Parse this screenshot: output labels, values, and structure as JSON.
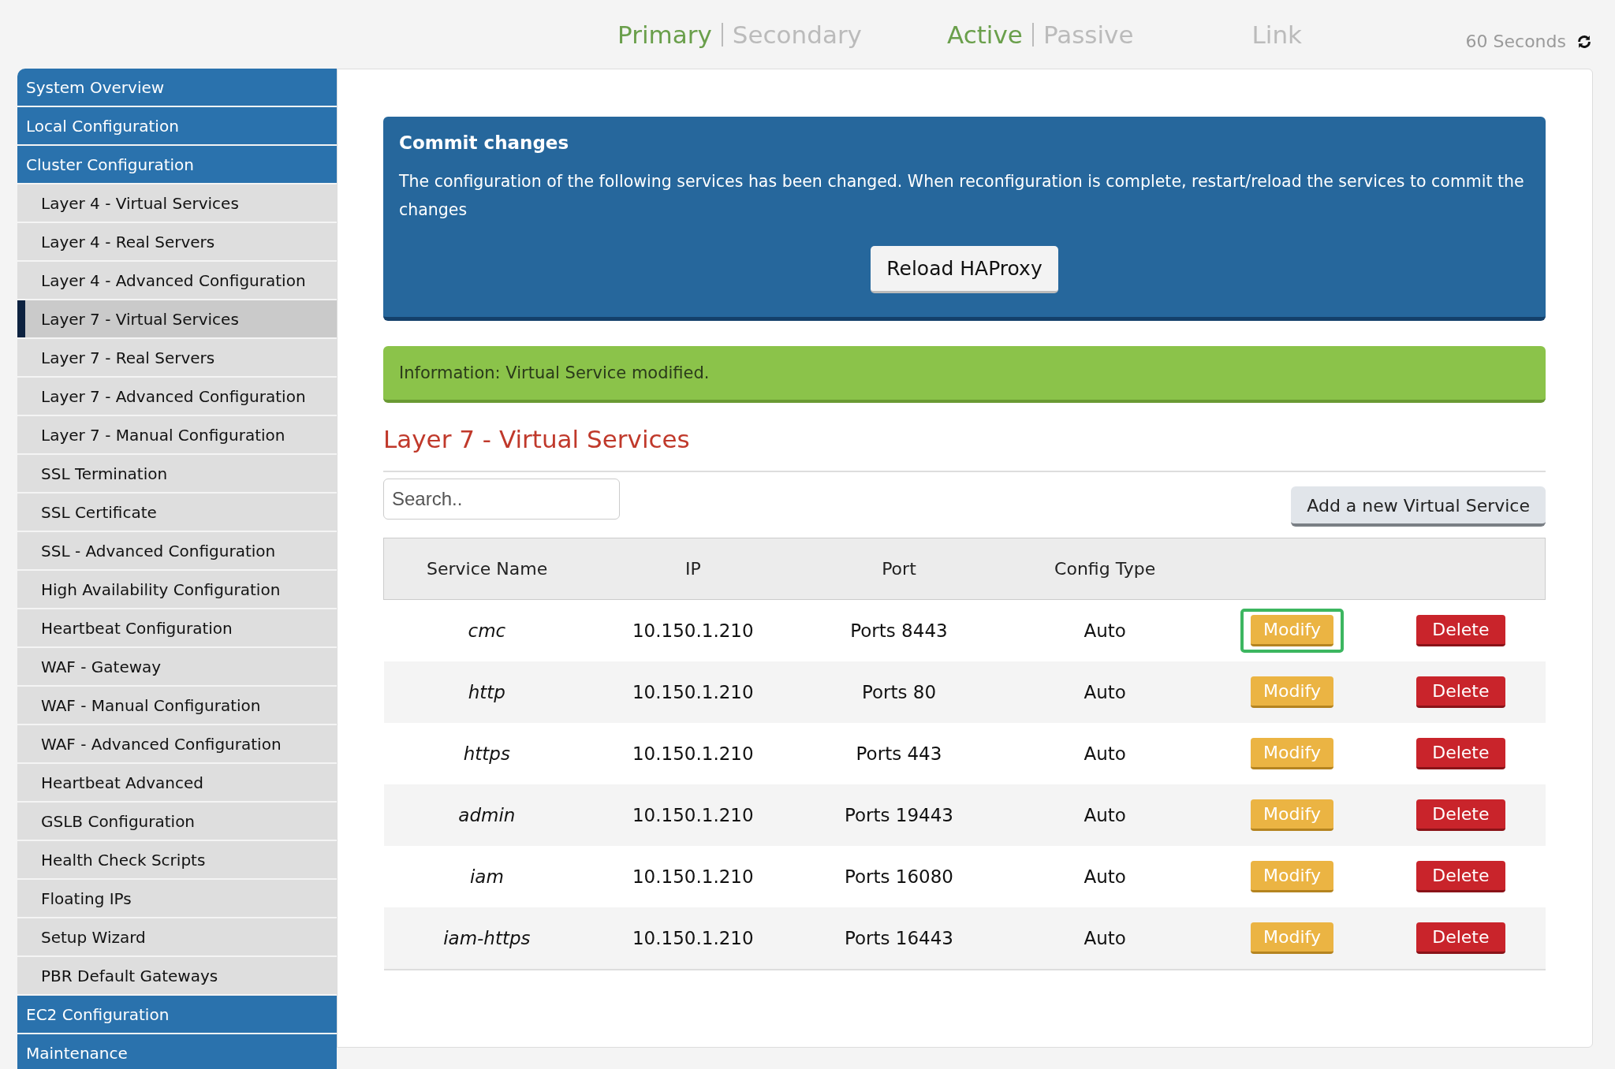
{
  "header": {
    "groups": [
      {
        "items": [
          {
            "label": "Primary",
            "active": true
          },
          {
            "label": "Secondary",
            "active": false
          }
        ]
      },
      {
        "items": [
          {
            "label": "Active",
            "active": true
          },
          {
            "label": "Passive",
            "active": false
          }
        ]
      },
      {
        "items": [
          {
            "label": "Link",
            "active": false
          }
        ]
      }
    ],
    "refresh": "60 Seconds"
  },
  "sidebar": {
    "items": [
      {
        "label": "System Overview",
        "kind": "section",
        "selected": false
      },
      {
        "label": "Local Configuration",
        "kind": "section",
        "selected": false
      },
      {
        "label": "Cluster Configuration",
        "kind": "section",
        "selected": false
      },
      {
        "label": "Layer 4 - Virtual Services",
        "kind": "sub",
        "selected": false
      },
      {
        "label": "Layer 4 - Real Servers",
        "kind": "sub",
        "selected": false
      },
      {
        "label": "Layer 4 - Advanced Configuration",
        "kind": "sub",
        "selected": false
      },
      {
        "label": "Layer 7 - Virtual Services",
        "kind": "sub",
        "selected": true
      },
      {
        "label": "Layer 7 - Real Servers",
        "kind": "sub",
        "selected": false
      },
      {
        "label": "Layer 7 - Advanced Configuration",
        "kind": "sub",
        "selected": false
      },
      {
        "label": "Layer 7 - Manual Configuration",
        "kind": "sub",
        "selected": false
      },
      {
        "label": "SSL Termination",
        "kind": "sub",
        "selected": false
      },
      {
        "label": "SSL Certificate",
        "kind": "sub",
        "selected": false
      },
      {
        "label": "SSL - Advanced Configuration",
        "kind": "sub",
        "selected": false
      },
      {
        "label": "High Availability Configuration",
        "kind": "sub",
        "selected": false
      },
      {
        "label": "Heartbeat Configuration",
        "kind": "sub",
        "selected": false
      },
      {
        "label": "WAF - Gateway",
        "kind": "sub",
        "selected": false
      },
      {
        "label": "WAF - Manual Configuration",
        "kind": "sub",
        "selected": false
      },
      {
        "label": "WAF - Advanced Configuration",
        "kind": "sub",
        "selected": false
      },
      {
        "label": "Heartbeat Advanced",
        "kind": "sub",
        "selected": false
      },
      {
        "label": "GSLB Configuration",
        "kind": "sub",
        "selected": false
      },
      {
        "label": "Health Check Scripts",
        "kind": "sub",
        "selected": false
      },
      {
        "label": "Floating IPs",
        "kind": "sub",
        "selected": false
      },
      {
        "label": "Setup Wizard",
        "kind": "sub",
        "selected": false
      },
      {
        "label": "PBR Default Gateways",
        "kind": "sub",
        "selected": false
      },
      {
        "label": "EC2 Configuration",
        "kind": "section",
        "selected": false
      },
      {
        "label": "Maintenance",
        "kind": "section",
        "selected": false
      }
    ]
  },
  "commit": {
    "title": "Commit changes",
    "message": "The configuration of the following services has been changed. When reconfiguration is complete, restart/reload the services to commit the changes",
    "button": "Reload HAProxy"
  },
  "info": "Information: Virtual Service modified.",
  "heading": "Layer 7 - Virtual Services",
  "search": {
    "placeholder": "Search.."
  },
  "add_button": "Add a new Virtual Service",
  "table": {
    "columns": [
      "Service Name",
      "IP",
      "Port",
      "Config Type"
    ],
    "rows": [
      {
        "name": "cmc",
        "ip": "10.150.1.210",
        "port": "Ports 8443",
        "type": "Auto",
        "modify": "Modify",
        "delete": "Delete",
        "highlighted": true
      },
      {
        "name": "http",
        "ip": "10.150.1.210",
        "port": "Ports 80",
        "type": "Auto",
        "modify": "Modify",
        "delete": "Delete",
        "highlighted": false
      },
      {
        "name": "https",
        "ip": "10.150.1.210",
        "port": "Ports 443",
        "type": "Auto",
        "modify": "Modify",
        "delete": "Delete",
        "highlighted": false
      },
      {
        "name": "admin",
        "ip": "10.150.1.210",
        "port": "Ports 19443",
        "type": "Auto",
        "modify": "Modify",
        "delete": "Delete",
        "highlighted": false
      },
      {
        "name": "iam",
        "ip": "10.150.1.210",
        "port": "Ports 16080",
        "type": "Auto",
        "modify": "Modify",
        "delete": "Delete",
        "highlighted": false
      },
      {
        "name": "iam-https",
        "ip": "10.150.1.210",
        "port": "Ports 16443",
        "type": "Auto",
        "modify": "Modify",
        "delete": "Delete",
        "highlighted": false
      }
    ]
  }
}
